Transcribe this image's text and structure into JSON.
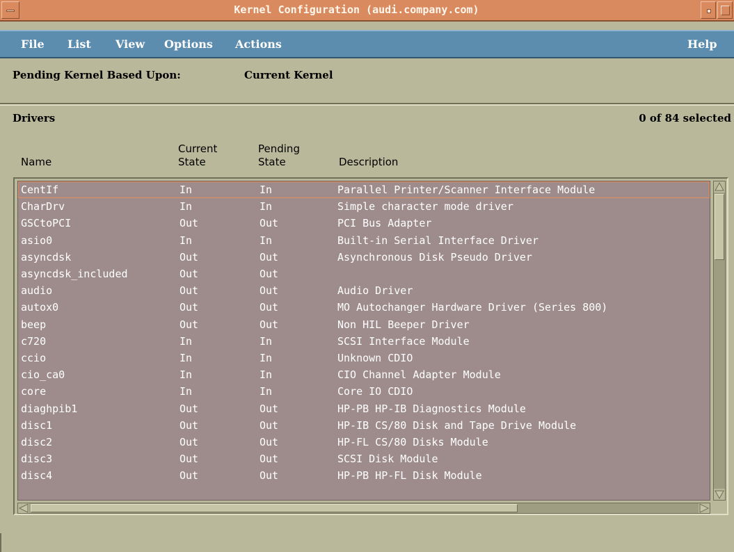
{
  "window": {
    "title": "Kernel Configuration (audi.company.com)"
  },
  "menubar": {
    "items": [
      "File",
      "List",
      "View",
      "Options",
      "Actions"
    ],
    "help": "Help"
  },
  "header": {
    "pending_label": "Pending Kernel Based Upon:",
    "pending_value": "Current Kernel"
  },
  "section": {
    "title": "Drivers",
    "selected_count": "0 of 84 selected"
  },
  "columns": {
    "name": "Name",
    "current": "Current\nState",
    "pending": "Pending\nState",
    "description": "Description"
  },
  "rows": [
    {
      "name": "CentIf",
      "current": "In",
      "pending": "In",
      "description": "Parallel Printer/Scanner Interface Module"
    },
    {
      "name": "CharDrv",
      "current": "In",
      "pending": "In",
      "description": "Simple character mode driver"
    },
    {
      "name": "GSCtoPCI",
      "current": "Out",
      "pending": "Out",
      "description": "PCI Bus Adapter"
    },
    {
      "name": "asio0",
      "current": "In",
      "pending": "In",
      "description": "Built-in Serial Interface Driver"
    },
    {
      "name": "asyncdsk",
      "current": "Out",
      "pending": "Out",
      "description": "Asynchronous Disk Pseudo Driver"
    },
    {
      "name": "asyncdsk_included",
      "current": "Out",
      "pending": "Out",
      "description": ""
    },
    {
      "name": "audio",
      "current": "Out",
      "pending": "Out",
      "description": "Audio Driver"
    },
    {
      "name": "autox0",
      "current": "Out",
      "pending": "Out",
      "description": "MO Autochanger Hardware Driver (Series 800)"
    },
    {
      "name": "beep",
      "current": "Out",
      "pending": "Out",
      "description": "Non HIL Beeper Driver"
    },
    {
      "name": "c720",
      "current": "In",
      "pending": "In",
      "description": "SCSI Interface Module"
    },
    {
      "name": "ccio",
      "current": "In",
      "pending": "In",
      "description": "Unknown CDIO"
    },
    {
      "name": "cio_ca0",
      "current": "In",
      "pending": "In",
      "description": "CIO Channel Adapter Module"
    },
    {
      "name": "core",
      "current": "In",
      "pending": "In",
      "description": "Core IO CDIO"
    },
    {
      "name": "diaghpib1",
      "current": "Out",
      "pending": "Out",
      "description": "HP-PB HP-IB Diagnostics Module"
    },
    {
      "name": "disc1",
      "current": "Out",
      "pending": "Out",
      "description": "HP-IB CS/80 Disk and Tape Drive Module"
    },
    {
      "name": "disc2",
      "current": "Out",
      "pending": "Out",
      "description": "HP-FL CS/80 Disks Module"
    },
    {
      "name": "disc3",
      "current": "Out",
      "pending": "Out",
      "description": "SCSI Disk Module"
    },
    {
      "name": "disc4",
      "current": "Out",
      "pending": "Out",
      "description": "HP-PB HP-FL Disk Module"
    }
  ],
  "colors": {
    "titlebar": "#d98a5f",
    "menubar": "#5c8cae",
    "window_bg": "#b9b89a",
    "list_bg": "#9e8c8d",
    "focus_outline": "#e48e5a"
  },
  "icons": {
    "window_menu": "window-menu-icon",
    "minimize": "minimize-icon",
    "maximize": "maximize-icon",
    "scroll_up": "arrow-up-icon",
    "scroll_down": "arrow-down-icon",
    "scroll_left": "arrow-left-icon",
    "scroll_right": "arrow-right-icon"
  }
}
